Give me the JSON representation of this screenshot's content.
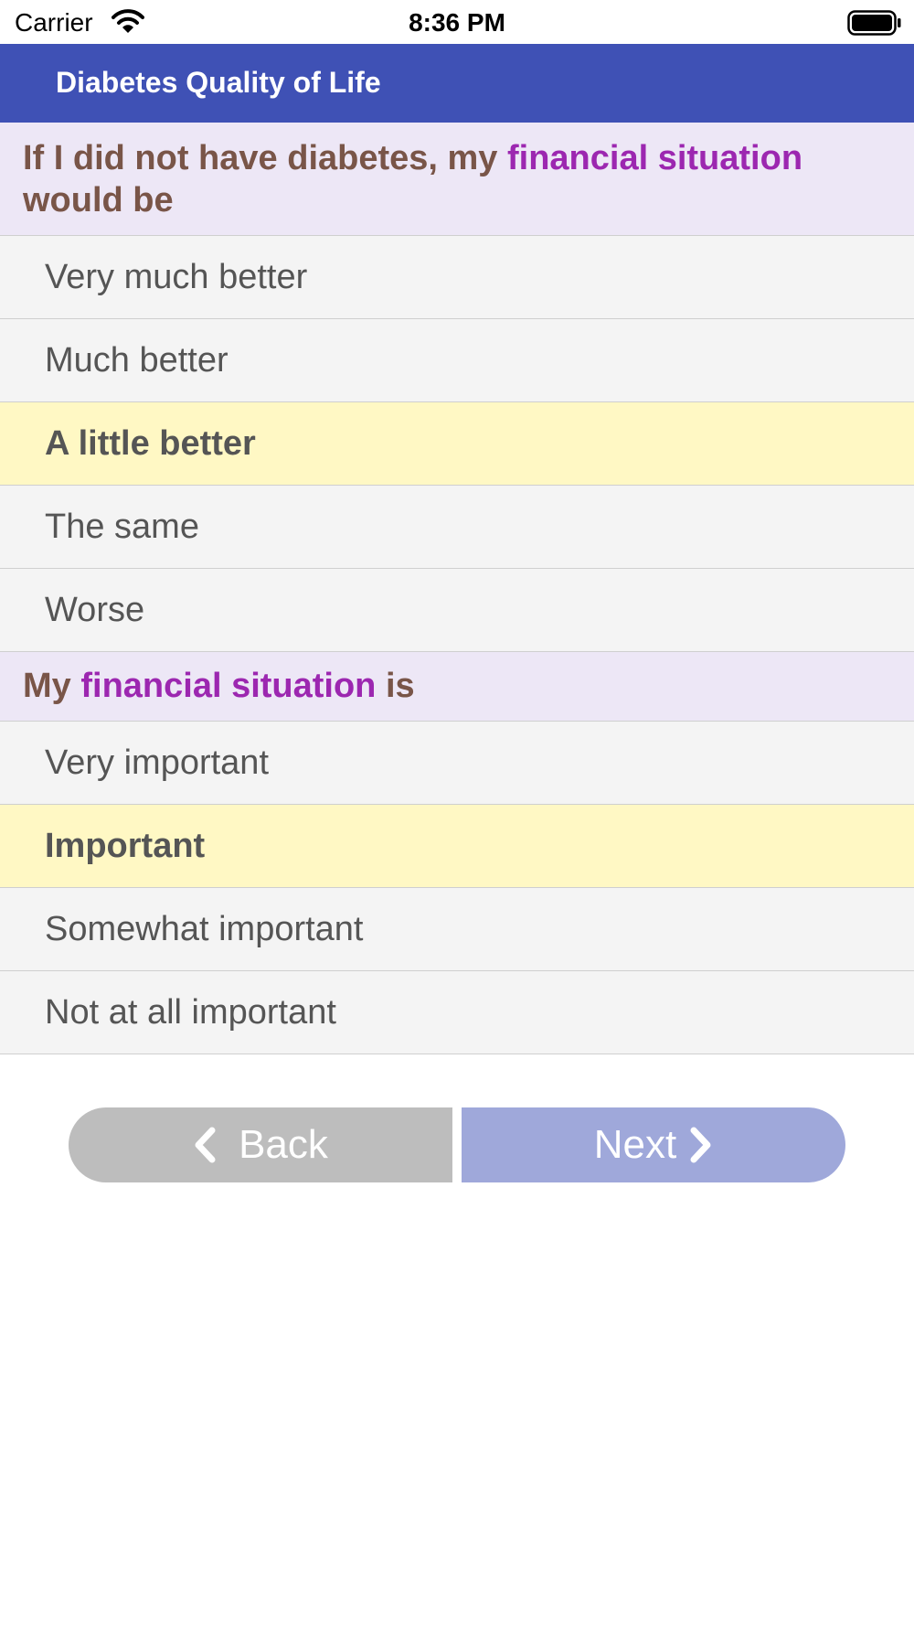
{
  "status_bar": {
    "carrier": "Carrier",
    "time": "8:36 PM",
    "icons": [
      "wifi-icon",
      "battery-icon"
    ]
  },
  "nav": {
    "title": "Diabetes Quality of Life",
    "background": "#3f51b5"
  },
  "questions": [
    {
      "prefix": "If I did not have diabetes, my ",
      "highlight": "financial situation",
      "suffix": " would be",
      "options": [
        "Very much better",
        "Much better",
        "A little better",
        "The same",
        "Worse"
      ],
      "selected": "A little better"
    },
    {
      "prefix": "My ",
      "highlight": "financial situation",
      "suffix": " is",
      "options": [
        "Very important",
        "Important",
        "Somewhat important",
        "Not at all important"
      ],
      "selected": "Important"
    }
  ],
  "buttons": {
    "back_label": "Back",
    "next_label": "Next"
  },
  "colors": {
    "question_bg": "#ede7f6",
    "question_text": "#795548",
    "highlight_text": "#9c27b0",
    "option_bg": "#f4f4f4",
    "selected_bg": "#fff8c4",
    "back_button": "#bdbdbd",
    "next_button": "#9fa8da"
  }
}
